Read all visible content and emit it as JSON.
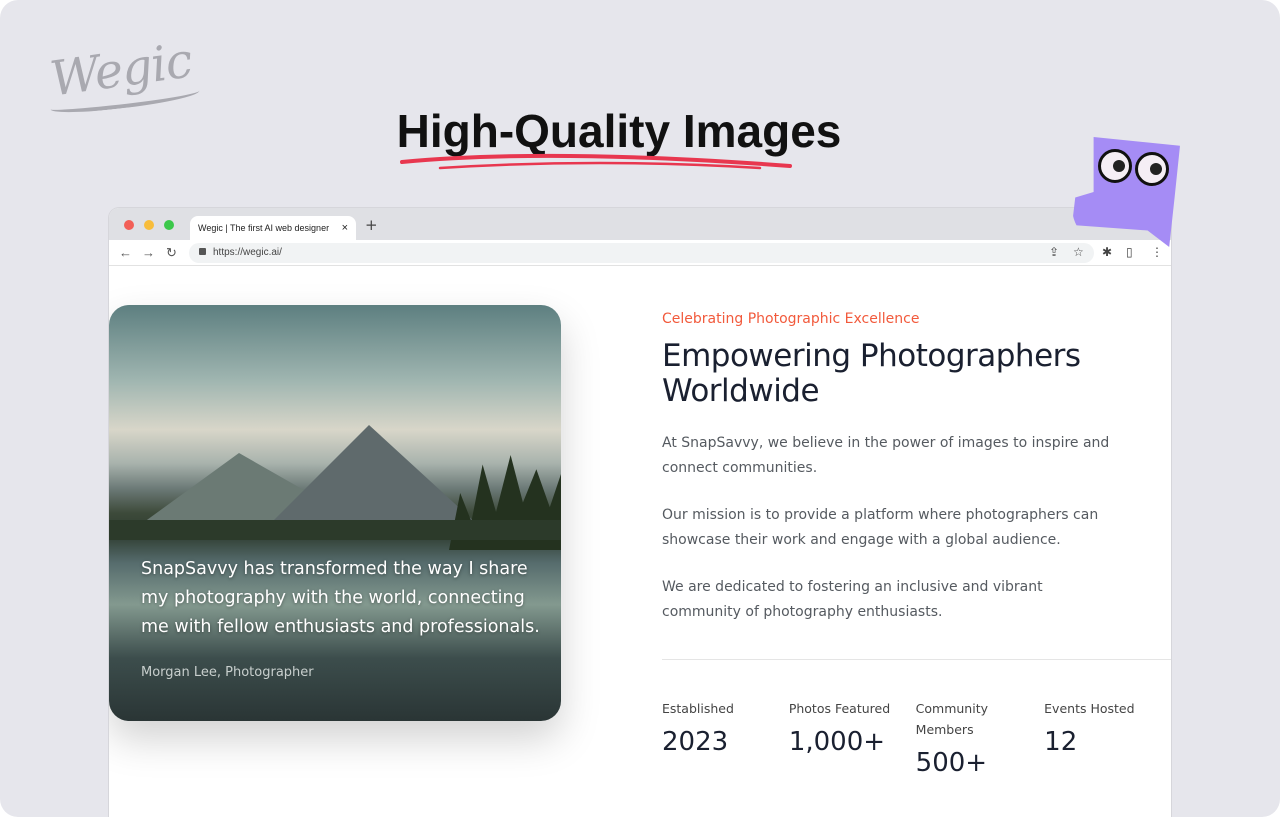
{
  "brand": {
    "logo_text": "Wegic",
    "headline": "High-Quality Images",
    "accent": "#e8374f"
  },
  "browser": {
    "tab_title": "Wegic | The first AI web designer",
    "tab_close": "×",
    "new_tab": "+",
    "url": "https://wegic.ai/",
    "nav": {
      "back": "←",
      "forward": "→",
      "reload": "↻"
    },
    "icons": {
      "share": "⇪",
      "star": "☆",
      "extensions": "✱",
      "sidepanel": "▯",
      "menu": "⋮"
    }
  },
  "testimonial": {
    "quote": "SnapSavvy has transformed the way I share my photography with the world, connecting me with fellow enthusiasts and professionals.",
    "author": "Morgan Lee, Photographer"
  },
  "about": {
    "eyebrow": "Celebrating Photographic Excellence",
    "eyebrow_color": "#f25a3c",
    "title": "Empowering Photographers Worldwide",
    "paragraphs": [
      "At SnapSavvy, we believe in the power of images to inspire and connect communities.",
      "Our mission is to provide a platform where photographers can showcase their work and engage with a global audience.",
      "We are dedicated to fostering an inclusive and vibrant community of photography enthusiasts."
    ],
    "stats": [
      {
        "label": "Established",
        "value": "2023"
      },
      {
        "label": "Photos Featured",
        "value": "1,000+"
      },
      {
        "label": "Community Members",
        "value": "500+"
      },
      {
        "label": "Events Hosted",
        "value": "12"
      }
    ]
  }
}
